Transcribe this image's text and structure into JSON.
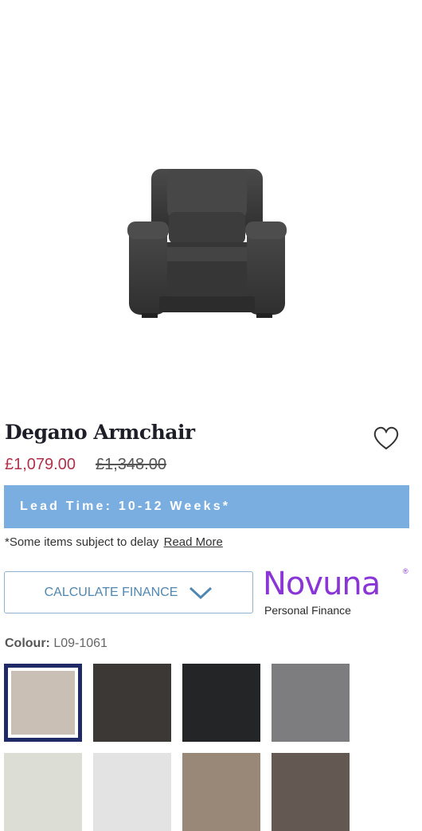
{
  "product": {
    "title": "Degano Armchair",
    "price_now": "£1,079.00",
    "price_was": "£1,348.00",
    "image_alt": "armchair-image"
  },
  "lead_time": {
    "text": "Lead Time: 10-12 Weeks*"
  },
  "delay_note": {
    "text": "*Some items subject to delay",
    "link": "Read More"
  },
  "finance": {
    "button_label": "CALCULATE FINANCE",
    "provider_name": "Novuna",
    "provider_reg": "®",
    "provider_sub": "Personal Finance"
  },
  "colour": {
    "label": "Colour:",
    "value": "L09-1061",
    "swatches": [
      {
        "color": "#c9bfb4",
        "selected": true
      },
      {
        "color": "#3b3835",
        "selected": false
      },
      {
        "color": "#232527",
        "selected": false
      },
      {
        "color": "#7d7d80",
        "selected": false
      },
      {
        "color": "#dcded6",
        "selected": false
      },
      {
        "color": "#e3e3e3",
        "selected": false
      },
      {
        "color": "#998877",
        "selected": false
      },
      {
        "color": "#645852",
        "selected": false
      }
    ]
  },
  "colors": {
    "accent_price": "#b0324a",
    "lead_bar": "#7aaee0",
    "finance_text": "#4f87b0",
    "brand_purple": "#8a35d6",
    "selected_border": "#1f2a66"
  }
}
